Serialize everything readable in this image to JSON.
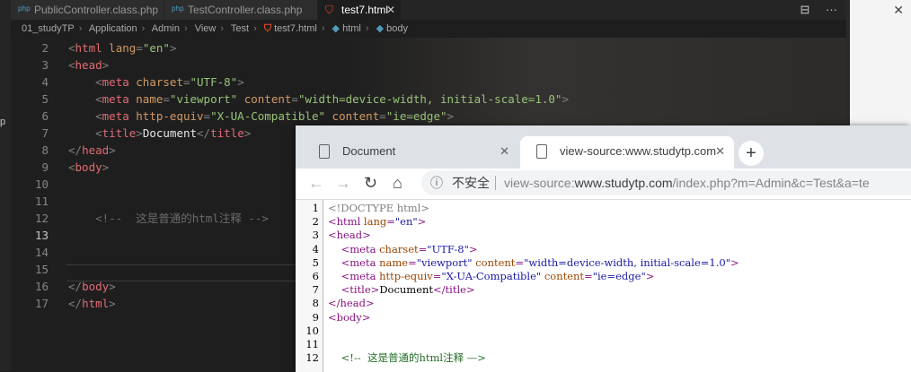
{
  "editor": {
    "tabs": [
      {
        "label": "PublicController.class.php",
        "icon": "php-icon"
      },
      {
        "label": "TestController.class.php",
        "icon": "php-icon"
      },
      {
        "label": "test7.html",
        "icon": "html5-icon",
        "close": "✕"
      }
    ],
    "breadcrumb": [
      "01_studyTP",
      "Application",
      "Admin",
      "View",
      "Test",
      "test7.html",
      "html",
      "body"
    ],
    "code_lines": [
      {
        "no": "2",
        "parts": [
          [
            "br",
            "<"
          ],
          [
            "tag",
            "html"
          ],
          [
            "attr",
            " lang"
          ],
          [
            "br",
            "="
          ],
          [
            "str",
            "\"en\""
          ],
          [
            "br",
            ">"
          ]
        ]
      },
      {
        "no": "3",
        "parts": [
          [
            "br",
            "<"
          ],
          [
            "tag",
            "head"
          ],
          [
            "br",
            ">"
          ]
        ]
      },
      {
        "no": "4",
        "parts": [
          [
            "br",
            "    <"
          ],
          [
            "tag",
            "meta"
          ],
          [
            "attr",
            " charset"
          ],
          [
            "br",
            "="
          ],
          [
            "str",
            "\"UTF-8\""
          ],
          [
            "br",
            ">"
          ]
        ]
      },
      {
        "no": "5",
        "parts": [
          [
            "br",
            "    <"
          ],
          [
            "tag",
            "meta"
          ],
          [
            "attr",
            " name"
          ],
          [
            "br",
            "="
          ],
          [
            "str",
            "\"viewport\""
          ],
          [
            "attr",
            " content"
          ],
          [
            "br",
            "="
          ],
          [
            "str",
            "\"width=device-width, initial-scale=1.0\""
          ],
          [
            "br",
            ">"
          ]
        ]
      },
      {
        "no": "6",
        "parts": [
          [
            "br",
            "    <"
          ],
          [
            "tag",
            "meta"
          ],
          [
            "attr",
            " http-equiv"
          ],
          [
            "br",
            "="
          ],
          [
            "str",
            "\"X-UA-Compatible\""
          ],
          [
            "attr",
            " content"
          ],
          [
            "br",
            "="
          ],
          [
            "str",
            "\"ie=edge\""
          ],
          [
            "br",
            ">"
          ]
        ]
      },
      {
        "no": "7",
        "parts": [
          [
            "br",
            "    <"
          ],
          [
            "tag",
            "title"
          ],
          [
            "br",
            ">"
          ],
          [
            "txt",
            "Document"
          ],
          [
            "br",
            "</"
          ],
          [
            "tag",
            "title"
          ],
          [
            "br",
            ">"
          ]
        ]
      },
      {
        "no": "8",
        "parts": [
          [
            "br",
            "</"
          ],
          [
            "tag",
            "head"
          ],
          [
            "br",
            ">"
          ]
        ]
      },
      {
        "no": "9",
        "parts": [
          [
            "br",
            "<"
          ],
          [
            "tag",
            "body"
          ],
          [
            "br",
            ">"
          ]
        ]
      },
      {
        "no": "10",
        "parts": []
      },
      {
        "no": "11",
        "parts": []
      },
      {
        "no": "12",
        "parts": [
          [
            "cmt",
            "    <!--  这是普通的html注释 -->"
          ]
        ]
      },
      {
        "no": "13",
        "parts": []
      },
      {
        "no": "14",
        "parts": []
      },
      {
        "no": "15",
        "parts": []
      },
      {
        "no": "16",
        "parts": [
          [
            "br",
            "</"
          ],
          [
            "tag",
            "body"
          ],
          [
            "br",
            ">"
          ]
        ]
      },
      {
        "no": "17",
        "parts": [
          [
            "br",
            "</"
          ],
          [
            "tag",
            "html"
          ],
          [
            "br",
            ">"
          ]
        ]
      }
    ],
    "current_line": "13"
  },
  "left_strip_text": "p",
  "browser": {
    "tabs": [
      {
        "label": "Document",
        "close": "✕"
      },
      {
        "label": "view-source:www.studytp.com",
        "close": "✕"
      }
    ],
    "new_tab": "+",
    "nav": {
      "back": "←",
      "forward": "→",
      "reload": "↻",
      "home": "⌂"
    },
    "address": {
      "info_icon": "ⓘ",
      "insecure_label": "不安全",
      "url_prefix": "view-source:",
      "url_host": "www.studytp.com",
      "url_rest": "/index.php?m=Admin&c=Test&a=te"
    },
    "source_lines": [
      {
        "no": "1",
        "parts": [
          [
            "doctype",
            "<!DOCTYPE html>"
          ]
        ]
      },
      {
        "no": "2",
        "parts": [
          [
            "tag",
            "<html"
          ],
          [
            "attr",
            " lang"
          ],
          [
            "tag",
            "="
          ],
          [
            "val",
            "\"en\""
          ],
          [
            "tag",
            ">"
          ]
        ]
      },
      {
        "no": "3",
        "parts": [
          [
            "tag",
            "<head>"
          ]
        ]
      },
      {
        "no": "4",
        "parts": [
          [
            "plain",
            "    "
          ],
          [
            "tag",
            "<meta"
          ],
          [
            "attr",
            " charset"
          ],
          [
            "tag",
            "="
          ],
          [
            "val",
            "\"UTF-8\""
          ],
          [
            "tag",
            ">"
          ]
        ]
      },
      {
        "no": "5",
        "parts": [
          [
            "plain",
            "    "
          ],
          [
            "tag",
            "<meta"
          ],
          [
            "attr",
            " name"
          ],
          [
            "tag",
            "="
          ],
          [
            "val",
            "\"viewport\""
          ],
          [
            "attr",
            " content"
          ],
          [
            "tag",
            "="
          ],
          [
            "val",
            "\"width=device-width, initial-scale=1.0\""
          ],
          [
            "tag",
            ">"
          ]
        ]
      },
      {
        "no": "6",
        "parts": [
          [
            "plain",
            "    "
          ],
          [
            "tag",
            "<meta"
          ],
          [
            "attr",
            " http-equiv"
          ],
          [
            "tag",
            "="
          ],
          [
            "val",
            "\"X-UA-Compatible\""
          ],
          [
            "attr",
            " content"
          ],
          [
            "tag",
            "="
          ],
          [
            "val",
            "\"ie=edge\""
          ],
          [
            "tag",
            ">"
          ]
        ]
      },
      {
        "no": "7",
        "parts": [
          [
            "plain",
            "    "
          ],
          [
            "tag",
            "<title>"
          ],
          [
            "plain",
            "Document"
          ],
          [
            "tag",
            "</title>"
          ]
        ]
      },
      {
        "no": "8",
        "parts": [
          [
            "tag",
            "</head>"
          ]
        ]
      },
      {
        "no": "9",
        "parts": [
          [
            "tag",
            "<body>"
          ]
        ]
      },
      {
        "no": "10",
        "parts": []
      },
      {
        "no": "11",
        "parts": []
      },
      {
        "no": "12",
        "parts": [
          [
            "plain",
            "    "
          ],
          [
            "cmt",
            "<!--  这是普通的html注释 —>"
          ]
        ]
      }
    ]
  },
  "window": {
    "close_glyph": "✕",
    "layout_glyph": "⊟",
    "more_glyph": "···"
  }
}
